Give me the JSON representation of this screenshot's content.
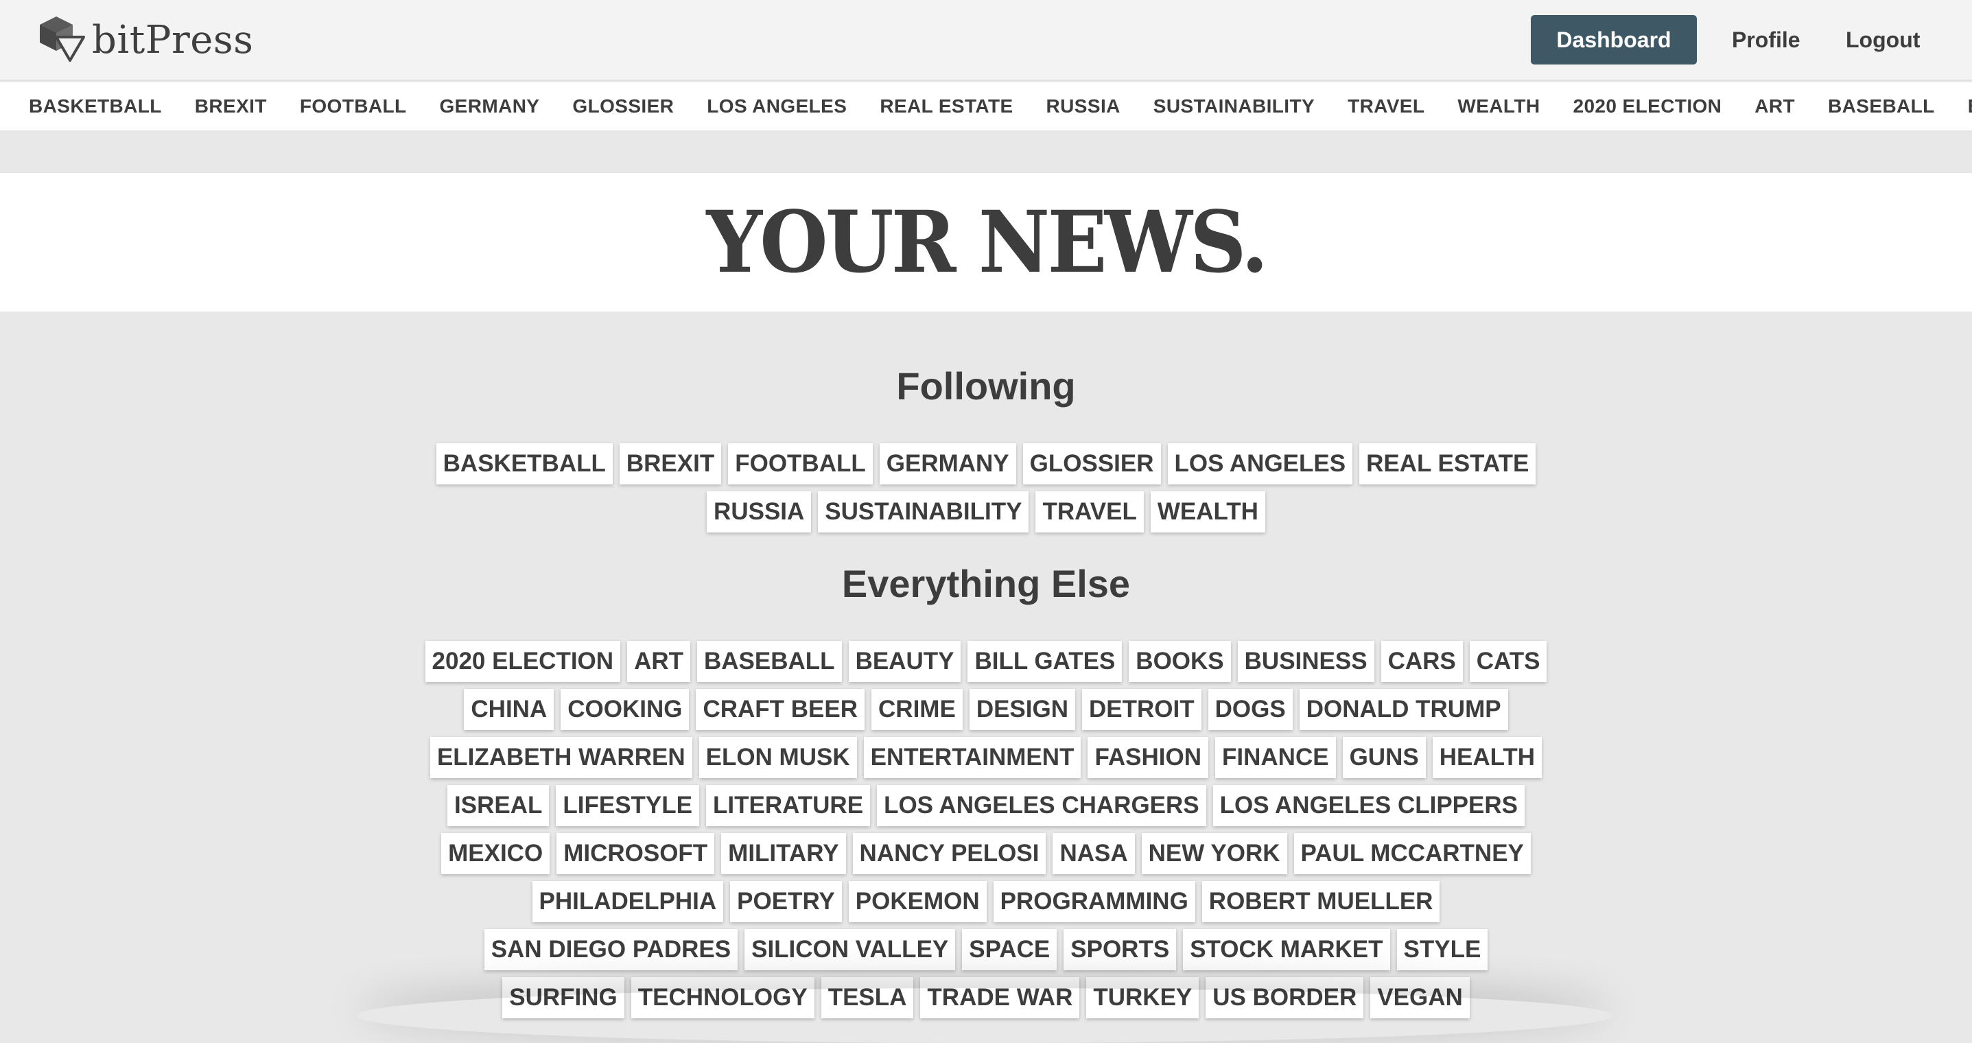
{
  "header": {
    "logo_text": "bitPress",
    "logo_icon": "cube-icon",
    "dashboard_label": "Dashboard",
    "profile_label": "Profile",
    "logout_label": "Logout",
    "accent_color": "#3e5965"
  },
  "strip": {
    "items": [
      "BASKETBALL",
      "BREXIT",
      "FOOTBALL",
      "GERMANY",
      "GLOSSIER",
      "LOS ANGELES",
      "REAL ESTATE",
      "RUSSIA",
      "SUSTAINABILITY",
      "TRAVEL",
      "WEALTH",
      "2020 ELECTION",
      "ART",
      "BASEBALL",
      "BEAUTY"
    ]
  },
  "hero": {
    "title": "YOUR NEWS."
  },
  "following": {
    "title": "Following",
    "rows": [
      [
        "BASKETBALL",
        "BREXIT",
        "FOOTBALL",
        "GERMANY",
        "GLOSSIER",
        "LOS ANGELES",
        "REAL ESTATE"
      ],
      [
        "RUSSIA",
        "SUSTAINABILITY",
        "TRAVEL",
        "WEALTH"
      ]
    ]
  },
  "everything_else": {
    "title": "Everything Else",
    "rows": [
      [
        "2020 ELECTION",
        "ART",
        "BASEBALL",
        "BEAUTY",
        "BILL GATES",
        "BOOKS",
        "BUSINESS",
        "CARS",
        "CATS"
      ],
      [
        "CHINA",
        "COOKING",
        "CRAFT BEER",
        "CRIME",
        "DESIGN",
        "DETROIT",
        "DOGS",
        "DONALD TRUMP"
      ],
      [
        "ELIZABETH WARREN",
        "ELON MUSK",
        "ENTERTAINMENT",
        "FASHION",
        "FINANCE",
        "GUNS",
        "HEALTH"
      ],
      [
        "ISREAL",
        "LIFESTYLE",
        "LITERATURE",
        "LOS ANGELES CHARGERS",
        "LOS ANGELES CLIPPERS"
      ],
      [
        "MEXICO",
        "MICROSOFT",
        "MILITARY",
        "NANCY PELOSI",
        "NASA",
        "NEW YORK",
        "PAUL MCCARTNEY"
      ],
      [
        "PHILADELPHIA",
        "POETRY",
        "POKEMON",
        "PROGRAMMING",
        "ROBERT MUELLER"
      ],
      [
        "SAN DIEGO PADRES",
        "SILICON VALLEY",
        "SPACE",
        "SPORTS",
        "STOCK MARKET",
        "STYLE"
      ],
      [
        "SURFING",
        "TECHNOLOGY",
        "TESLA",
        "TRADE WAR",
        "TURKEY",
        "US BORDER",
        "VEGAN"
      ]
    ]
  }
}
